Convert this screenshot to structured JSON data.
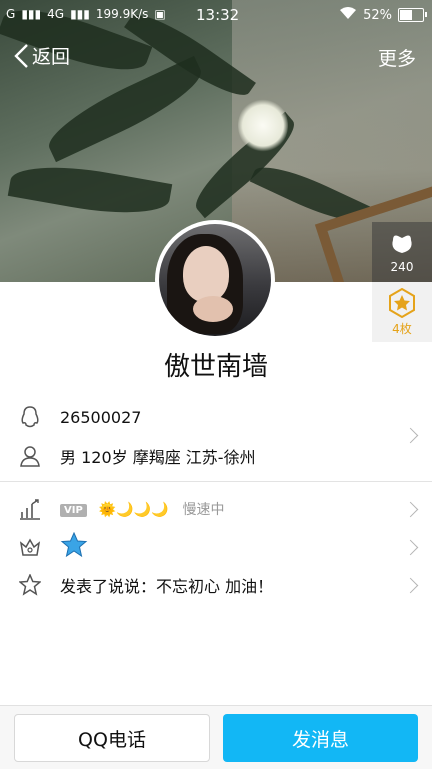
{
  "status_bar": {
    "signal_left": "G",
    "network": "4G",
    "speed": "199.9K/s",
    "time": "13:32",
    "battery": "52%",
    "battery_level": 0.52
  },
  "nav": {
    "back_label": "返回",
    "more_label": "更多"
  },
  "side": {
    "likes_count": "240",
    "medals": "4枚"
  },
  "profile": {
    "name": "傲世南墙",
    "qq_number": "26500027",
    "details": "男   120岁   摩羯座   江苏-徐州"
  },
  "rows": {
    "vip_badge": "VIP",
    "level_moons": "🌞🌙🌙🌙",
    "speed_status": "慢速中",
    "status_post": "发表了说说：不忘初心 加油！"
  },
  "actions": {
    "call_label": "QQ电话",
    "message_label": "发消息"
  },
  "colors": {
    "accent": "#12b7f5",
    "medal": "#e5a31a"
  }
}
